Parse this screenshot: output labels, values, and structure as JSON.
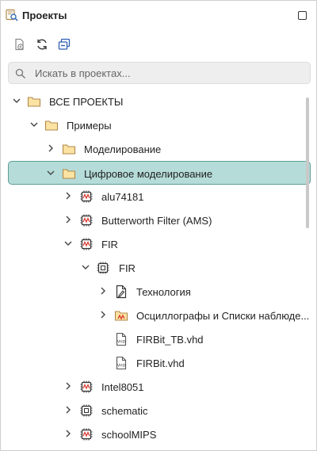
{
  "header": {
    "title": "Проекты"
  },
  "search": {
    "placeholder": "Искать в проектах..."
  },
  "tree": {
    "items": [
      {
        "label": "ВСЕ ПРОЕКТЫ",
        "expanded": true,
        "icon": "folder-icon"
      },
      {
        "label": "Примеры",
        "expanded": true,
        "icon": "folder-icon"
      },
      {
        "label": "Моделирование",
        "expanded": false,
        "icon": "folder-icon"
      },
      {
        "label": "Цифровое моделирование",
        "expanded": true,
        "icon": "folder-icon",
        "selected": true
      },
      {
        "label": "alu74181",
        "expanded": false,
        "icon": "chip-wave-icon"
      },
      {
        "label": "Butterworth Filter  (AMS)",
        "expanded": false,
        "icon": "chip-wave-icon"
      },
      {
        "label": "FIR",
        "expanded": true,
        "icon": "chip-wave-icon"
      },
      {
        "label": "FIR",
        "expanded": true,
        "icon": "chip-icon"
      },
      {
        "label": "Технология",
        "expanded": false,
        "icon": "technology-doc-icon"
      },
      {
        "label": "Осциллографы и Списки наблюде...",
        "expanded": false,
        "icon": "scope-folder-icon"
      },
      {
        "label": "FIRBit_TB.vhd",
        "icon": "vhd-file-icon"
      },
      {
        "label": "FIRBit.vhd",
        "icon": "vhd-file-icon"
      },
      {
        "label": "Intel8051",
        "expanded": false,
        "icon": "chip-wave-icon"
      },
      {
        "label": "schematic",
        "expanded": false,
        "icon": "chip-icon"
      },
      {
        "label": "schoolMIPS",
        "expanded": false,
        "icon": "chip-wave-icon"
      }
    ]
  },
  "colors": {
    "selection_bg": "#b5dcd8",
    "selection_border": "#5e9e98",
    "folder_fill": "#fde3a3",
    "folder_stroke": "#b0884a",
    "wave_red": "#d9342b"
  }
}
